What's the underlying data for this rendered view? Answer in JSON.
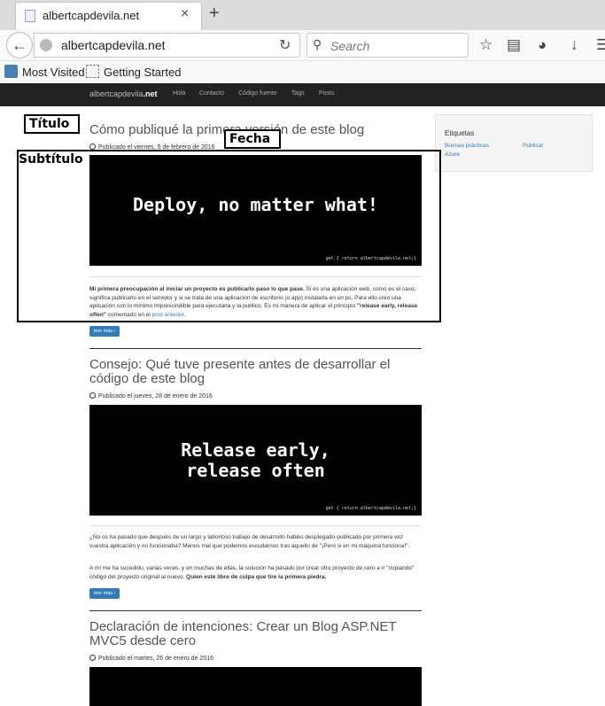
{
  "browser": {
    "tab_title": "albertcapdevila.net",
    "tab_close": "×",
    "new_tab": "+",
    "url": "albertcapdevila.net",
    "search_placeholder": "Search",
    "bookmarks": [
      "Most Visited",
      "Getting Started"
    ]
  },
  "site": {
    "brand_prefix": "albertcapdevila",
    "brand_suffix": ".net",
    "nav": [
      "Hola",
      "Contacto",
      "Código fuente",
      "Tags",
      "Posts"
    ]
  },
  "posts": [
    {
      "title": "Cómo publiqué la primera versión de este blog",
      "date": "Publicado el viernes, 5 de febrero de 2016",
      "banner_text": "Deploy, no matter what!",
      "banner_small": "get { return albertcapdevila.net;}",
      "p1_bold": "Mi primera preocupación al iniciar un proyecto es publicarlo paso lo que pase.",
      "p1_rest": " Si es una aplicación web, como es el caso, significa publicarlo en el servidor y si se trata de una aplicación de escritorio (o app) instalarla en un pc. Para ello creo una aplicación con lo mínimo imprescindible para ejecutarla y la publico. Es mi manera de aplicar el principio ",
      "p1_quote": "\"release early, release often\"",
      "p1_after": " comentado en el ",
      "p1_link": "post anterior",
      "p1_end": ".",
      "button": "leer más"
    },
    {
      "title": "Consejo: Qué tuve presente antes de desarrollar el código de este blog",
      "date": "Publicado el jueves, 28 de enero de 2016",
      "banner_line1": "Release early,",
      "banner_line2": "release often",
      "banner_small": "get { return albertcapdevila.net;}",
      "p1": "¿No os ha pasado que después de un largo y laborioso trabajo de desarrollo habéis desplegado-publicado por primera vez vuestra aplicación y no funcionaba? Menos mal que podemos escudarnos tras aquello de \"¡Pero si en mi máquina funciona!\".",
      "p2": "A mí me ha sucedido, varias veces, y en muchas de ellas, la solución ha pasado por crear otro proyecto de cero e ir \"copiando\" código del proyecto original al nuevo. ",
      "p2_bold": "Quien esté libre de culpa que tire la primera piedra.",
      "button": "leer más"
    },
    {
      "title": "Declaración de intenciones: Crear un Blog ASP.NET MVC5 desde cero",
      "date": "Publicado el martes, 26 de enero de 2016"
    }
  ],
  "sidebar": {
    "title": "Etiquetas",
    "tags": [
      "Buenas prácticas",
      "Publicar",
      "Azure"
    ]
  },
  "annotations": {
    "titulo": "Título",
    "fecha": "Fecha",
    "subtitulo": "Subtítulo"
  }
}
